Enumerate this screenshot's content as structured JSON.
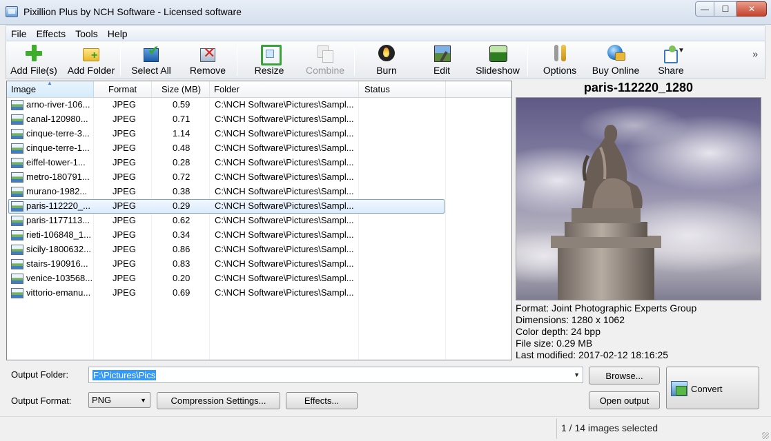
{
  "window": {
    "title": "Pixillion Plus by NCH Software - Licensed software",
    "controls": {
      "minimize": "—",
      "maximize": "☐",
      "close": "✕"
    }
  },
  "menu": [
    "File",
    "Effects",
    "Tools",
    "Help"
  ],
  "toolbar": {
    "add_files": "Add File(s)",
    "add_folder": "Add Folder",
    "select_all": "Select All",
    "remove": "Remove",
    "resize": "Resize",
    "combine": "Combine",
    "burn": "Burn",
    "edit": "Edit",
    "slideshow": "Slideshow",
    "options": "Options",
    "buy_online": "Buy Online",
    "share": "Share",
    "overflow": "»"
  },
  "file_list": {
    "columns": [
      "Image",
      "Format",
      "Size (MB)",
      "Folder",
      "Status"
    ],
    "selected_index": 7,
    "rows": [
      {
        "name": "arno-river-106...",
        "format": "JPEG",
        "size": "0.59",
        "folder": "C:\\NCH Software\\Pictures\\Sampl..."
      },
      {
        "name": "canal-120980...",
        "format": "JPEG",
        "size": "0.71",
        "folder": "C:\\NCH Software\\Pictures\\Sampl..."
      },
      {
        "name": "cinque-terre-3...",
        "format": "JPEG",
        "size": "1.14",
        "folder": "C:\\NCH Software\\Pictures\\Sampl..."
      },
      {
        "name": "cinque-terre-1...",
        "format": "JPEG",
        "size": "0.48",
        "folder": "C:\\NCH Software\\Pictures\\Sampl..."
      },
      {
        "name": "eiffel-tower-1...",
        "format": "JPEG",
        "size": "0.28",
        "folder": "C:\\NCH Software\\Pictures\\Sampl..."
      },
      {
        "name": "metro-180791...",
        "format": "JPEG",
        "size": "0.72",
        "folder": "C:\\NCH Software\\Pictures\\Sampl..."
      },
      {
        "name": "murano-1982...",
        "format": "JPEG",
        "size": "0.38",
        "folder": "C:\\NCH Software\\Pictures\\Sampl..."
      },
      {
        "name": "paris-112220_...",
        "format": "JPEG",
        "size": "0.29",
        "folder": "C:\\NCH Software\\Pictures\\Sampl..."
      },
      {
        "name": "paris-1177113...",
        "format": "JPEG",
        "size": "0.62",
        "folder": "C:\\NCH Software\\Pictures\\Sampl..."
      },
      {
        "name": "rieti-106848_1...",
        "format": "JPEG",
        "size": "0.34",
        "folder": "C:\\NCH Software\\Pictures\\Sampl..."
      },
      {
        "name": "sicily-1800632...",
        "format": "JPEG",
        "size": "0.86",
        "folder": "C:\\NCH Software\\Pictures\\Sampl..."
      },
      {
        "name": "stairs-190916...",
        "format": "JPEG",
        "size": "0.83",
        "folder": "C:\\NCH Software\\Pictures\\Sampl..."
      },
      {
        "name": "venice-103568...",
        "format": "JPEG",
        "size": "0.20",
        "folder": "C:\\NCH Software\\Pictures\\Sampl..."
      },
      {
        "name": "vittorio-emanu...",
        "format": "JPEG",
        "size": "0.69",
        "folder": "C:\\NCH Software\\Pictures\\Sampl..."
      }
    ]
  },
  "preview": {
    "title": "paris-112220_1280",
    "format": "Format: Joint Photographic Experts Group",
    "dimensions": "Dimensions: 1280 x 1062",
    "color_depth": "Color depth: 24 bpp",
    "file_size": "File size: 0.29 MB",
    "last_modified": "Last modified: 2017-02-12 18:16:25"
  },
  "output": {
    "folder_label": "Output Folder:",
    "folder_value": "F:\\Pictures\\Pics",
    "format_label": "Output Format:",
    "format_value": "PNG",
    "browse": "Browse...",
    "open_output": "Open output",
    "compression": "Compression Settings...",
    "effects": "Effects...",
    "convert": "Convert"
  },
  "status": {
    "text": "1 / 14 images selected"
  }
}
